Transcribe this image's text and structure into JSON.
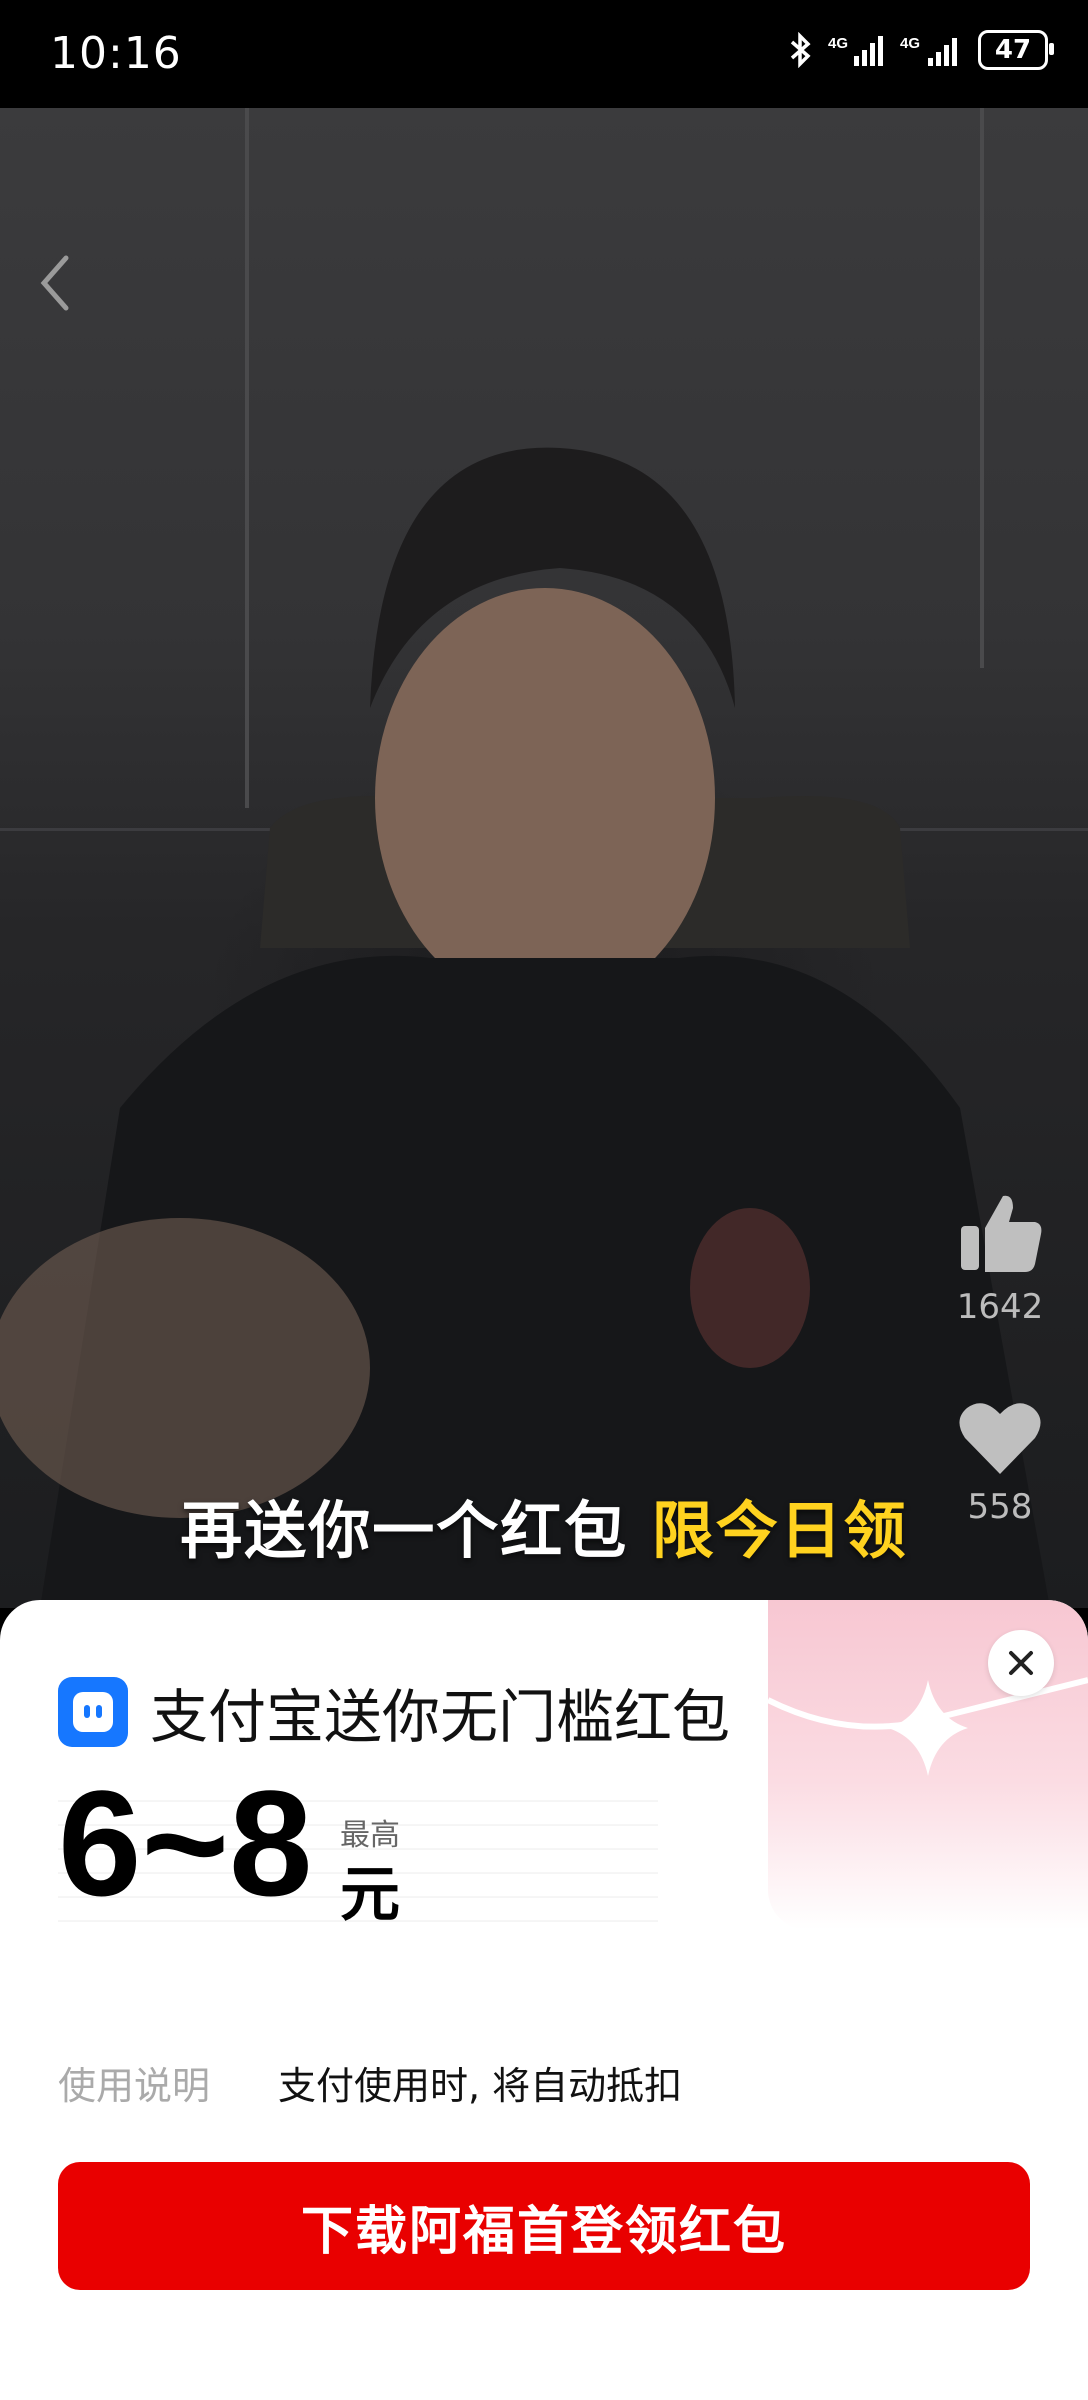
{
  "status_bar": {
    "time": "10:16",
    "battery": "47",
    "network": [
      "4G",
      "4G"
    ]
  },
  "video": {
    "subtitle_main": "再送你一个红包",
    "subtitle_highlight": "限今日领",
    "like_count": "1642",
    "favorite_count": "558"
  },
  "offer": {
    "title": "支付宝送你无门槛红包",
    "amount": "6~8",
    "amount_prefix": "最高",
    "amount_unit": "元",
    "usage_label": "使用说明",
    "usage_text": "支付使用时, 将自动抵扣",
    "cta_label": "下载阿福首登领红包"
  },
  "colors": {
    "cta": "#e90000",
    "highlight": "#ffd21f",
    "alipay_blue": "#1677ff",
    "deco_pink": "#f7c7d2"
  }
}
